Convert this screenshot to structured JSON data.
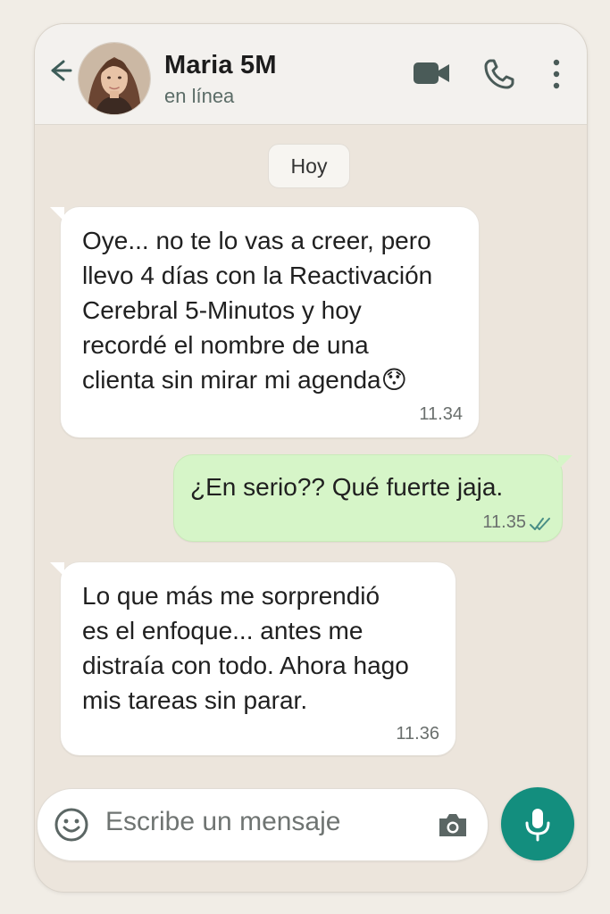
{
  "header": {
    "contact_name": "Maria 5M",
    "status": "en línea",
    "avatar_alt": "contact-photo"
  },
  "chat": {
    "date_separator": "Hoy",
    "messages": [
      {
        "direction": "incoming",
        "text": "Oye... no te lo vas a creer, pero\nllevo 4 días con la Reactivación\nCerebral 5-Minutos y hoy\nrecordé el nombre de una\nclienta sin mirar mi agenda😯",
        "time": "11.34"
      },
      {
        "direction": "outgoing",
        "text": "¿En serio?? Qué fuerte jaja.",
        "time": "11.35",
        "read": true
      },
      {
        "direction": "incoming",
        "text": "Lo que más me sorprendió\nes el enfoque... antes me\ndistraía con todo. Ahora hago\nmis tareas sin parar.",
        "time": "11.36"
      }
    ]
  },
  "composer": {
    "placeholder": "Escribe un mensaje"
  },
  "colors": {
    "accent": "#138e7e",
    "outgoing_bubble": "#d6f5c8",
    "incoming_bubble": "#ffffff",
    "chat_background": "#ece5dc",
    "read_ticks": "#34b7f1"
  },
  "icons": {
    "back": "arrow-left-icon",
    "video": "video-camera-icon",
    "call": "phone-icon",
    "menu": "more-vertical-icon",
    "emoji": "emoji-icon",
    "camera": "camera-icon",
    "mic": "microphone-icon"
  }
}
